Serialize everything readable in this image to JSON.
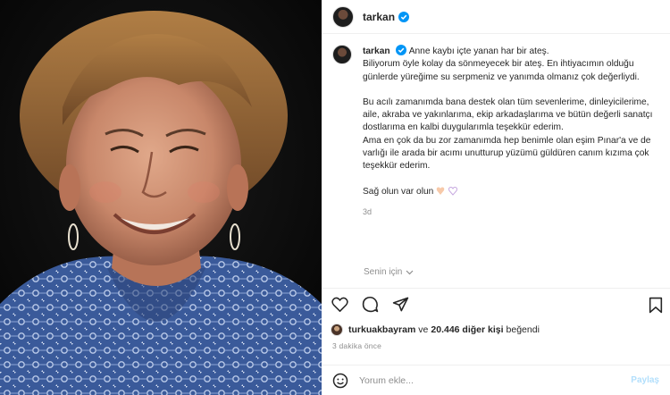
{
  "post": {
    "username": "tarkan",
    "caption": {
      "line1": "Anne kaybı içte yanan har bir ateş.",
      "p1": "Biliyorum öyle kolay da sönmeyecek bir ateş. En ihtiyacımın olduğu günlerde yüreğime su serpmeniz ve yanımda olmanız çok değerliydi.",
      "p2": "Bu acılı zamanımda bana destek olan tüm sevenlerime, dinleyicilerime, aile, akraba ve yakınlarıma, ekip arkadaşlarıma ve bütün değerli sanatçı dostlarıma en kalbi duygularımla teşekkür ederim.",
      "p3": "Ama en çok da bu zor zamanımda hep benimle olan eşim Pınar'a ve de varlığı ile arada bir acımı unutturup yüzümü güldüren canım kızıma çok teşekkür ederim.",
      "p4": "Sağ olun var olun"
    },
    "caption_time": "3d",
    "translation_label": "Senin için",
    "likes": {
      "liker": "turkuakbayram",
      "connector": "ve",
      "others": "20.446 diğer kişi",
      "suffix": "beğendi"
    },
    "posted_ago": "3 dakika önce",
    "comment": {
      "placeholder": "Yorum ekle...",
      "post_label": "Paylaş"
    }
  },
  "icons": {
    "verified": "verified-badge-icon",
    "like": "heart-icon",
    "comment": "comment-bubble-icon",
    "share": "paper-plane-icon",
    "save": "bookmark-icon",
    "emoji": "smiley-icon",
    "chevron": "chevron-down-icon"
  },
  "colors": {
    "verified_blue": "#0095f6",
    "muted": "#8e8e8e",
    "text": "#262626",
    "post_btn": "#b2dffc"
  }
}
